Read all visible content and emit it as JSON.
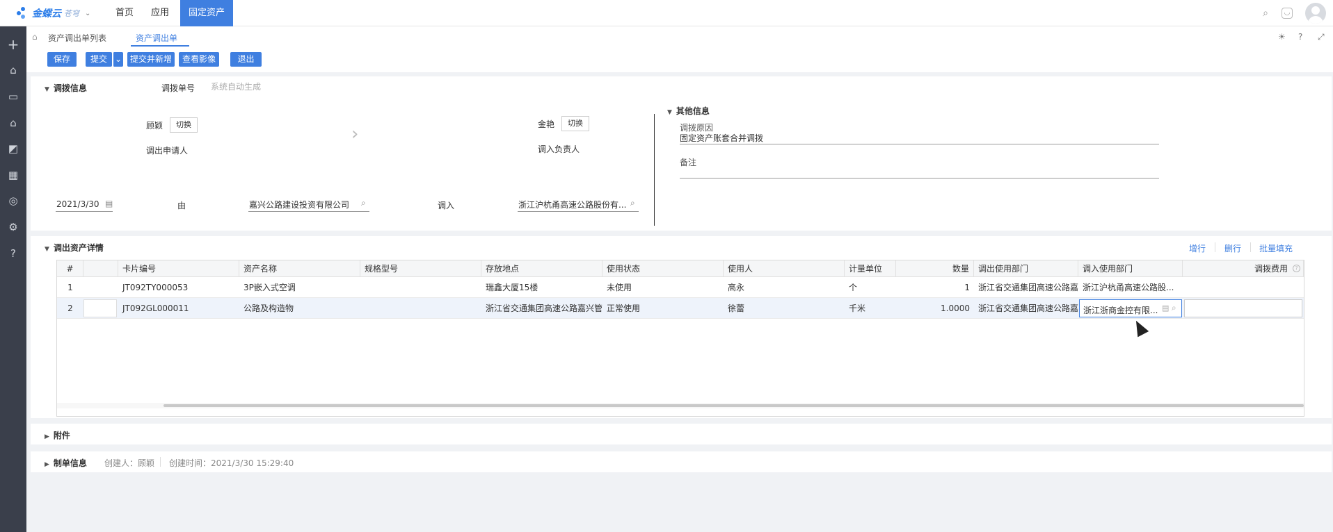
{
  "app": {
    "brand": "金蝶云",
    "brand_sub": "苍穹",
    "nav": [
      "首页",
      "应用",
      "固定资产"
    ]
  },
  "breadcrumb": {
    "items": [
      "资产调出单列表",
      "资产调出单"
    ]
  },
  "toolbar": {
    "save": "保存",
    "submit": "提交",
    "submit_new": "提交并新增",
    "view_image": "查看影像",
    "exit": "退出"
  },
  "transfer_info": {
    "section_title": "调拨信息",
    "doc_no_label": "调拨单号",
    "doc_no_placeholder": "系统自动生成",
    "out_person": "顾颖",
    "switch_label": "切换",
    "out_applicant_label": "调出申请人",
    "in_person": "金艳",
    "in_switch_label": "切换",
    "in_manager_label": "调入负责人",
    "date": "2021/3/30",
    "from_label": "由",
    "from_company": "嘉兴公路建设投资有限公司",
    "to_label": "调入",
    "to_company": "浙江沪杭甬高速公路股份有..."
  },
  "other_info": {
    "section_title": "其他信息",
    "reason_label": "调拨原因",
    "reason_value": "固定资产账套合并调拨",
    "remark_label": "备注"
  },
  "detail": {
    "section_title": "调出资产详情",
    "actions": [
      "增行",
      "删行",
      "批量填充"
    ],
    "columns": [
      "#",
      "",
      "卡片编号",
      "资产名称",
      "规格型号",
      "存放地点",
      "使用状态",
      "使用人",
      "计量单位",
      "数量",
      "调出使用部门",
      "调入使用部门",
      "调拨费用"
    ],
    "rows": [
      {
        "no": "1",
        "card": "JT092TY000053",
        "name": "3P嵌入式空调",
        "spec": "",
        "location": "瑞鑫大厦15楼",
        "status": "未使用",
        "user": "高永",
        "unit": "个",
        "qty": "1",
        "out_dept": "浙江省交通集团高速公路嘉兴",
        "in_dept": "浙江沪杭甬高速公路股...",
        "fee": ""
      },
      {
        "no": "2",
        "card": "JT092GL000011",
        "name": "公路及构造物",
        "spec": "",
        "location": "浙江省交通集团高速公路嘉兴管理",
        "status": "正常使用",
        "user": "徐蕾",
        "unit": "千米",
        "qty": "1.0000",
        "out_dept": "浙江省交通集团高速公路嘉兴",
        "in_dept": "浙江浙商金控有限...",
        "fee": ""
      }
    ]
  },
  "attachment": {
    "section_title": "附件"
  },
  "maker_info": {
    "section_title": "制单信息",
    "creator": "创建人：顾颖",
    "created_time": "创建时间：2021/3/30 15:29:40"
  },
  "colors": {
    "accent": "#3f7fe0",
    "sidebar": "#3a3f4b"
  }
}
